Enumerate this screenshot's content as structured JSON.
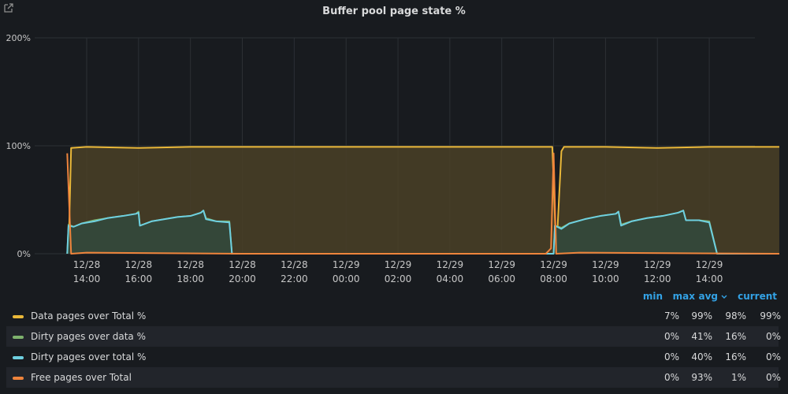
{
  "panel": {
    "title": "Buffer pool page state %",
    "link_icon": "external-link-icon"
  },
  "colors": {
    "background": "#181b1f",
    "grid": "#2c3035",
    "accent": "#33a2e5"
  },
  "chart_data": {
    "type": "area",
    "title": "Buffer pool page state %",
    "xlabel": "",
    "ylabel": "",
    "ylim": [
      0,
      200
    ],
    "y_ticks": [
      "0%",
      "100%",
      "200%"
    ],
    "x_ticks": [
      {
        "date": "12/28",
        "time": "14:00",
        "h": 0
      },
      {
        "date": "12/28",
        "time": "16:00",
        "h": 2
      },
      {
        "date": "12/28",
        "time": "18:00",
        "h": 4
      },
      {
        "date": "12/28",
        "time": "20:00",
        "h": 6
      },
      {
        "date": "12/28",
        "time": "22:00",
        "h": 8
      },
      {
        "date": "12/29",
        "time": "00:00",
        "h": 10
      },
      {
        "date": "12/29",
        "time": "02:00",
        "h": 12
      },
      {
        "date": "12/29",
        "time": "04:00",
        "h": 14
      },
      {
        "date": "12/29",
        "time": "06:00",
        "h": 16
      },
      {
        "date": "12/29",
        "time": "08:00",
        "h": 18
      },
      {
        "date": "12/29",
        "time": "10:00",
        "h": 20
      },
      {
        "date": "12/29",
        "time": "12:00",
        "h": 22
      },
      {
        "date": "12/29",
        "time": "14:00",
        "h": 24
      }
    ],
    "grid": true,
    "legend_placement": "bottom",
    "series": [
      {
        "name": "Data pages over Total %",
        "color": "#eab839",
        "fill": "#4a3f27",
        "points": [
          [
            -0.7,
            0
          ],
          [
            -0.6,
            98
          ],
          [
            0,
            99
          ],
          [
            2,
            98
          ],
          [
            4,
            99
          ],
          [
            6,
            99
          ],
          [
            10,
            99
          ],
          [
            14,
            99
          ],
          [
            17.95,
            99
          ],
          [
            18.1,
            0
          ],
          [
            18.3,
            95
          ],
          [
            18.4,
            99
          ],
          [
            20,
            99
          ],
          [
            22,
            98
          ],
          [
            24,
            99
          ],
          [
            26.7,
            99
          ]
        ],
        "stats": {
          "min": "7%",
          "max": "99%",
          "avg": "98%",
          "current": "99%"
        }
      },
      {
        "name": "Dirty pages over data %",
        "color": "#7eb26d",
        "fill": "#34483a",
        "points": [
          [
            -0.75,
            0
          ],
          [
            -0.7,
            27
          ],
          [
            -0.5,
            25
          ],
          [
            -0.2,
            28
          ],
          [
            0.3,
            31
          ],
          [
            0.8,
            33
          ],
          [
            1.4,
            35
          ],
          [
            1.9,
            37
          ],
          [
            2.0,
            39
          ],
          [
            2.05,
            26
          ],
          [
            2.5,
            30
          ],
          [
            3.0,
            32
          ],
          [
            3.5,
            34
          ],
          [
            4.0,
            35
          ],
          [
            4.4,
            38
          ],
          [
            4.5,
            40
          ],
          [
            4.6,
            33
          ],
          [
            5.0,
            30
          ],
          [
            5.5,
            30
          ],
          [
            5.6,
            0
          ],
          [
            18.0,
            0
          ],
          [
            18.05,
            26
          ],
          [
            18.3,
            24
          ],
          [
            18.6,
            28
          ],
          [
            19.2,
            32
          ],
          [
            19.8,
            35
          ],
          [
            20.4,
            37
          ],
          [
            20.5,
            39
          ],
          [
            20.6,
            27
          ],
          [
            21.0,
            30
          ],
          [
            21.6,
            33
          ],
          [
            22.2,
            35
          ],
          [
            22.8,
            38
          ],
          [
            23.0,
            40
          ],
          [
            23.1,
            31
          ],
          [
            23.6,
            31
          ],
          [
            24.0,
            30
          ],
          [
            24.3,
            0
          ],
          [
            26.7,
            0
          ]
        ],
        "stats": {
          "min": "0%",
          "max": "41%",
          "avg": "16%",
          "current": "0%"
        }
      },
      {
        "name": "Dirty pages over total %",
        "color": "#6ed0e0",
        "fill": "#34483a",
        "points": [
          [
            -0.75,
            0
          ],
          [
            -0.7,
            26
          ],
          [
            -0.5,
            25
          ],
          [
            -0.2,
            28
          ],
          [
            0.3,
            30
          ],
          [
            0.8,
            33
          ],
          [
            1.4,
            35
          ],
          [
            1.9,
            37
          ],
          [
            2.0,
            38
          ],
          [
            2.05,
            26
          ],
          [
            2.5,
            30
          ],
          [
            3.0,
            32
          ],
          [
            3.5,
            34
          ],
          [
            4.0,
            35
          ],
          [
            4.4,
            38
          ],
          [
            4.5,
            40
          ],
          [
            4.6,
            32
          ],
          [
            5.0,
            30
          ],
          [
            5.5,
            29
          ],
          [
            5.6,
            0
          ],
          [
            18.0,
            0
          ],
          [
            18.05,
            26
          ],
          [
            18.3,
            23
          ],
          [
            18.6,
            28
          ],
          [
            19.2,
            32
          ],
          [
            19.8,
            35
          ],
          [
            20.4,
            37
          ],
          [
            20.5,
            39
          ],
          [
            20.6,
            26
          ],
          [
            21.0,
            30
          ],
          [
            21.6,
            33
          ],
          [
            22.2,
            35
          ],
          [
            22.8,
            38
          ],
          [
            23.0,
            40
          ],
          [
            23.1,
            31
          ],
          [
            23.6,
            31
          ],
          [
            24.0,
            29
          ],
          [
            24.3,
            0
          ],
          [
            26.7,
            0
          ]
        ],
        "stats": {
          "min": "0%",
          "max": "40%",
          "avg": "16%",
          "current": "0%"
        }
      },
      {
        "name": "Free pages over Total",
        "color": "#ef843c",
        "fill": "none",
        "points": [
          [
            -0.75,
            93
          ],
          [
            -0.6,
            0
          ],
          [
            0,
            1
          ],
          [
            6,
            0
          ],
          [
            17.7,
            0
          ],
          [
            17.9,
            5
          ],
          [
            18.0,
            93
          ],
          [
            18.1,
            0
          ],
          [
            19,
            1
          ],
          [
            26.7,
            0
          ]
        ],
        "stats": {
          "min": "0%",
          "max": "93%",
          "avg": "1%",
          "current": "0%"
        }
      }
    ]
  },
  "legend": {
    "headers": {
      "min": "min",
      "max": "max",
      "avg": "avg",
      "current": "current"
    },
    "sort_icon": "chevron-down-icon"
  }
}
